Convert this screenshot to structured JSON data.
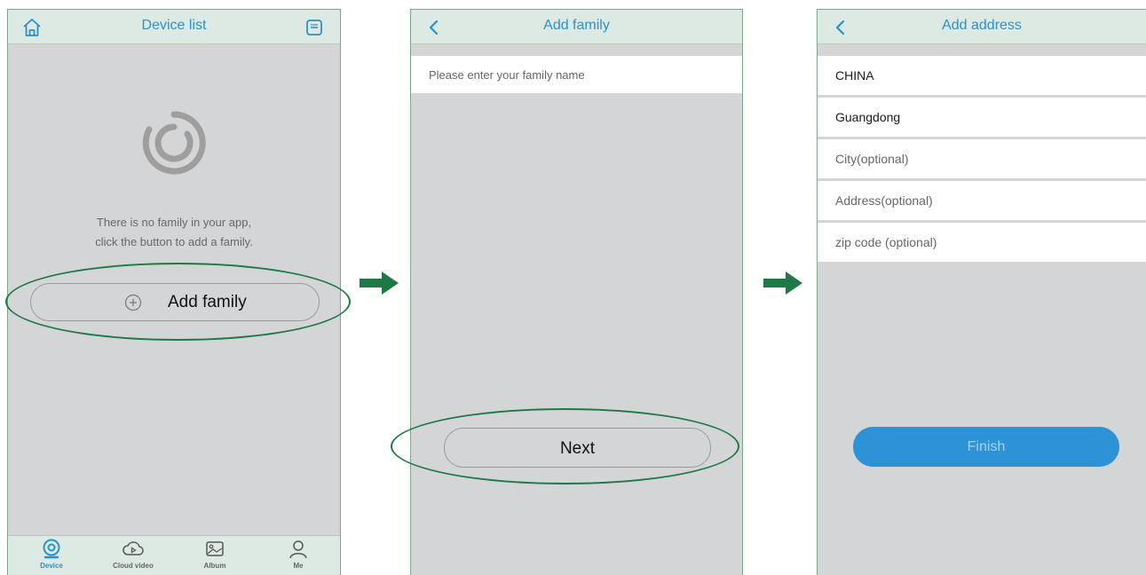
{
  "screen1": {
    "title": "Device list",
    "empty_line1": "There is no family in your app,",
    "empty_line2": "click the button to add a family.",
    "add_family_label": "Add family",
    "tabs": [
      {
        "label": "Device",
        "icon": "camera-icon",
        "active": true
      },
      {
        "label": "Cloud video",
        "icon": "cloud-play-icon",
        "active": false
      },
      {
        "label": "Album",
        "icon": "image-icon",
        "active": false
      },
      {
        "label": "Me",
        "icon": "person-icon",
        "active": false
      }
    ]
  },
  "screen2": {
    "title": "Add family",
    "family_name_placeholder": "Please enter your family name",
    "next_label": "Next"
  },
  "screen3": {
    "title": "Add address",
    "country_value": "CHINA",
    "province_value": "Guangdong",
    "city_placeholder": "City(optional)",
    "address_placeholder": "Address(optional)",
    "zip_placeholder": "zip code (optional)",
    "finish_label": "Finish"
  },
  "colors": {
    "accent": "#2a91cc",
    "highlight": "#1d7a46",
    "finish_button": "#2e93d6"
  }
}
